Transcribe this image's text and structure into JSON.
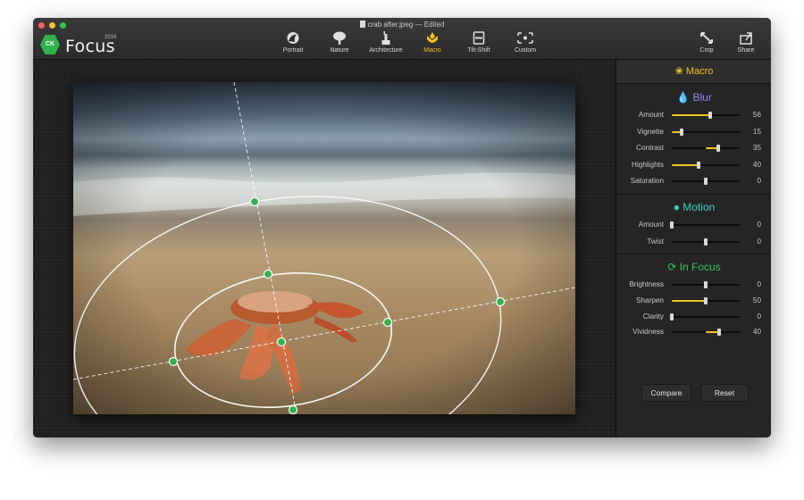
{
  "window": {
    "title": "crab after.jpeg",
    "edited": "— Edited"
  },
  "app": {
    "logo_text": "CK",
    "name": "Focus",
    "year": "2016"
  },
  "modes": [
    {
      "label": "Portrait",
      "icon": "portrait-icon"
    },
    {
      "label": "Nature",
      "icon": "tree-icon"
    },
    {
      "label": "Architecture",
      "icon": "statue-icon"
    },
    {
      "label": "Macro",
      "icon": "flower-icon",
      "active": true
    },
    {
      "label": "Tilt-Shift",
      "icon": "tilt-shift-icon"
    },
    {
      "label": "Custom",
      "icon": "custom-icon"
    }
  ],
  "tools": [
    {
      "label": "Crop",
      "icon": "crop-icon"
    },
    {
      "label": "Share",
      "icon": "share-icon"
    }
  ],
  "panel": {
    "title": "Macro",
    "blur": {
      "title": "Blur",
      "sliders": [
        {
          "label": "Amount",
          "value": "56",
          "level": 0.56,
          "fill": true
        },
        {
          "label": "Vignette",
          "value": "15",
          "level": 0.15,
          "fill": true
        },
        {
          "label": "Contrast",
          "value": "35",
          "level": 0.68,
          "fill": true,
          "from_center": true
        },
        {
          "label": "Highlights",
          "value": "40",
          "level": 0.4,
          "fill": true
        },
        {
          "label": "Saturation",
          "value": "0",
          "level": 0.5,
          "fill": false
        }
      ]
    },
    "motion": {
      "title": "Motion",
      "sliders": [
        {
          "label": "Amount",
          "value": "0",
          "level": 0.0,
          "fill": false
        },
        {
          "label": "Twist",
          "value": "0",
          "level": 0.5,
          "fill": false
        }
      ]
    },
    "in_focus": {
      "title": "In Focus",
      "sliders": [
        {
          "label": "Brightness",
          "value": "0",
          "level": 0.5,
          "fill": false
        },
        {
          "label": "Sharpen",
          "value": "50",
          "level": 0.5,
          "fill": true
        },
        {
          "label": "Clarity",
          "value": "0",
          "level": 0.0,
          "fill": false
        },
        {
          "label": "Vividness",
          "value": "40",
          "level": 0.7,
          "fill": true,
          "from_center": true
        }
      ]
    },
    "buttons": {
      "compare": "Compare",
      "reset": "Reset"
    }
  },
  "colors": {
    "accent": "#f2c21b",
    "blur": "#8f88e8",
    "motion": "#3fd0c4",
    "in_focus": "#38c25a",
    "handle": "#2fb24a"
  }
}
